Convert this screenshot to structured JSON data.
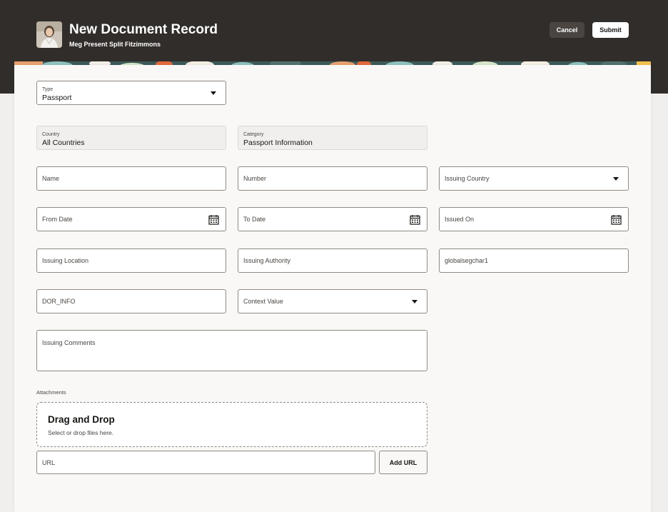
{
  "header": {
    "title": "New Document Record",
    "subtitle": "Meg Present Split Fitzimmons",
    "cancel_label": "Cancel",
    "submit_label": "Submit",
    "background": "#312d2a"
  },
  "form": {
    "type": {
      "label": "Type",
      "value": "Passport"
    },
    "country": {
      "label": "Country",
      "value": "All Countries"
    },
    "category": {
      "label": "Category",
      "value": "Passport Information"
    },
    "name": {
      "label": "Name"
    },
    "number": {
      "label": "Number"
    },
    "issuing_country": {
      "label": "Issuing Country"
    },
    "from_date": {
      "label": "From Date"
    },
    "to_date": {
      "label": "To Date"
    },
    "issued_on": {
      "label": "Issued On"
    },
    "issuing_location": {
      "label": "Issuing Location"
    },
    "issuing_authority": {
      "label": "Issuing Authority"
    },
    "globalsegchar1": {
      "label": "globalsegchar1"
    },
    "dor_info": {
      "label": "DOR_INFO"
    },
    "context_value": {
      "label": "Context Value"
    },
    "issuing_comments": {
      "label": "Issuing Comments"
    }
  },
  "attachments": {
    "label": "Attachments",
    "dropzone_title": "Drag and Drop",
    "dropzone_subtitle": "Select or drop files here.",
    "url_label": "URL",
    "add_url_label": "Add URL"
  },
  "icons": {
    "dropdown": "chevron-down-icon",
    "date": "calendar-icon"
  }
}
